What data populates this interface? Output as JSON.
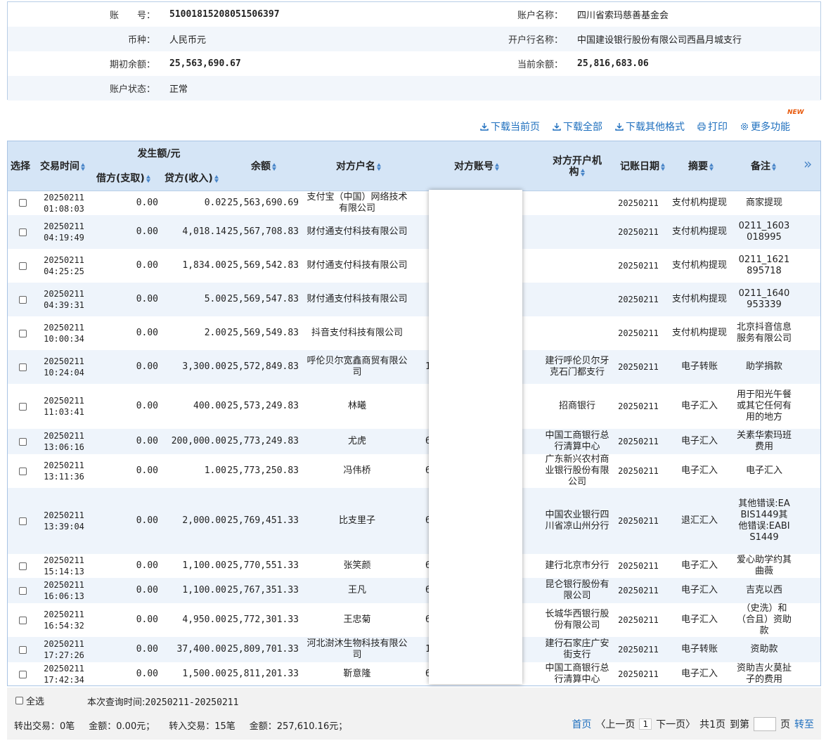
{
  "account": {
    "account_no_label": "账　　号：",
    "account_no": "51001815208051506397",
    "account_name_label": "账户名称：",
    "account_name": "四川省索玛慈善基金会",
    "currency_label": "币种：",
    "currency": "人民币元",
    "bank_label": "开户行名称：",
    "bank": "中国建设银行股份有限公司西昌月城支行",
    "opening_label": "期初余额：",
    "opening": "25,563,690.67",
    "current_label": "当前余额：",
    "current": "25,816,683.06",
    "status_label": "账户状态：",
    "status": "正常"
  },
  "toolbar": {
    "download_page": "下载当前页",
    "download_all": "下载全部",
    "download_other": "下载其他格式",
    "print": "打印",
    "more": "更多功能",
    "new_badge": "NEW"
  },
  "table": {
    "headers": {
      "select": "选择",
      "time": "交易时间",
      "amount_group": "发生额/元",
      "debit": "借方(支取)",
      "credit": "贷方(收入)",
      "balance": "余额",
      "counterparty": "对方户名",
      "counter_account": "对方账号",
      "counter_bank": "对方开户机构",
      "post_date": "记账日期",
      "summary": "摘要",
      "remark": "备注",
      "more": "»"
    },
    "rows": [
      {
        "time": "20250211 01:08:03",
        "debit": "0.00",
        "credit": "0.02",
        "balance": "25,563,690.69",
        "name": "支付宝（中国）网络技术有限公司",
        "acc": "",
        "bank": "",
        "date": "20250211",
        "summary": "支付机构提现",
        "note": "商家提现"
      },
      {
        "time": "20250211 04:19:49",
        "debit": "0.00",
        "credit": "4,018.14",
        "balance": "25,567,708.83",
        "name": "财付通支付科技有限公司",
        "acc": "",
        "bank": "",
        "date": "20250211",
        "summary": "支付机构提现",
        "note": "0211_1603018995"
      },
      {
        "time": "20250211 04:25:25",
        "debit": "0.00",
        "credit": "1,834.00",
        "balance": "25,569,542.83",
        "name": "财付通支付科技有限公司",
        "acc": "",
        "bank": "",
        "date": "20250211",
        "summary": "支付机构提现",
        "note": "0211_1621895718"
      },
      {
        "time": "20250211 04:39:31",
        "debit": "0.00",
        "credit": "5.00",
        "balance": "25,569,547.83",
        "name": "财付通支付科技有限公司",
        "acc": "",
        "bank": "",
        "date": "20250211",
        "summary": "支付机构提现",
        "note": "0211_1640953339"
      },
      {
        "time": "20250211 10:00:34",
        "debit": "0.00",
        "credit": "2.00",
        "balance": "25,569,549.83",
        "name": "抖音支付科技有限公司",
        "acc": "",
        "bank": "",
        "date": "20250211",
        "summary": "支付机构提现",
        "note": "北京抖音信息服务有限公司"
      },
      {
        "time": "20250211 10:24:04",
        "debit": "0.00",
        "credit": "3,300.00",
        "balance": "25,572,849.83",
        "name": "呼伦贝尔宽鑫商贸有限公司",
        "acc": "1",
        "bank": "建行呼伦贝尔牙克石门都支行",
        "date": "20250211",
        "summary": "电子转账",
        "note": "助学捐款"
      },
      {
        "time": "20250211 11:03:41",
        "debit": "0.00",
        "credit": "400.00",
        "balance": "25,573,249.83",
        "name": "林曦",
        "acc": "",
        "bank": "招商银行",
        "date": "20250211",
        "summary": "电子汇入",
        "note": "用于阳光午餐或其它任何有用的地方"
      },
      {
        "time": "20250211 13:06:16",
        "debit": "0.00",
        "credit": "200,000.00",
        "balance": "25,773,249.83",
        "name": "尤虎",
        "acc": "6",
        "bank": "中国工商银行总行清算中心",
        "date": "20250211",
        "summary": "电子汇入",
        "note": "关素华索玛班费用"
      },
      {
        "time": "20250211 13:11:36",
        "debit": "0.00",
        "credit": "1.00",
        "balance": "25,773,250.83",
        "name": "冯伟桥",
        "acc": "6",
        "bank": "广东新兴农村商业银行股份有限公司",
        "date": "20250211",
        "summary": "电子汇入",
        "note": "电子汇入"
      },
      {
        "time": "20250211 13:39:04",
        "debit": "0.00",
        "credit": "2,000.00",
        "balance": "25,769,451.33",
        "name": "比支里子",
        "acc": "6",
        "bank": "中国农业银行四川省凉山州分行",
        "date": "20250211",
        "summary": "退汇汇入",
        "note": "其他错误:EABIS1449其他错误:EABIS1449"
      },
      {
        "time": "20250211 15:14:13",
        "debit": "0.00",
        "credit": "1,100.00",
        "balance": "25,770,551.33",
        "name": "张笑颜",
        "acc": "6",
        "bank": "建行北京市分行",
        "date": "20250211",
        "summary": "电子汇入",
        "note": "爱心助学约其曲薇"
      },
      {
        "time": "20250211 16:06:13",
        "debit": "0.00",
        "credit": "1,100.00",
        "balance": "25,767,351.33",
        "name": "王凡",
        "acc": "6",
        "bank": "昆仑银行股份有限公司",
        "date": "20250211",
        "summary": "电子汇入",
        "note": "吉克以西"
      },
      {
        "time": "20250211 16:54:32",
        "debit": "0.00",
        "credit": "4,950.00",
        "balance": "25,772,301.33",
        "name": "王忠菊",
        "acc": "6",
        "bank": "长城华西银行股份有限公司",
        "date": "20250211",
        "summary": "电子汇入",
        "note": "（史洗）和（合且）资助款"
      },
      {
        "time": "20250211 17:27:26",
        "debit": "0.00",
        "credit": "37,400.00",
        "balance": "25,809,701.33",
        "name": "河北澍沐生物科技有限公司",
        "acc": "1",
        "bank": "建行石家庄广安街支行",
        "date": "20250211",
        "summary": "电子转账",
        "note": "资助款"
      },
      {
        "time": "20250211 17:42:34",
        "debit": "0.00",
        "credit": "1,500.00",
        "balance": "25,811,201.33",
        "name": "靳意隆",
        "acc": "6",
        "bank": "中国工商银行总行清算中心",
        "date": "20250211",
        "summary": "电子汇入",
        "note": "资助吉火莫扯子的费用"
      }
    ]
  },
  "footer": {
    "select_all": "全选",
    "query_label": "本次查询时间:",
    "query_range": "20250211-20250211",
    "out_txn": "转出交易：0笔",
    "out_amt": "金额：0.00元；",
    "in_txn": "转入交易：15笔",
    "in_amt": "金额：257,610.16元；",
    "first": "首页",
    "prev": "〈上一页",
    "page": "1",
    "next": "下一页〉",
    "total": "共1页",
    "goto": "到第",
    "page_unit": "页",
    "go": "转至"
  }
}
